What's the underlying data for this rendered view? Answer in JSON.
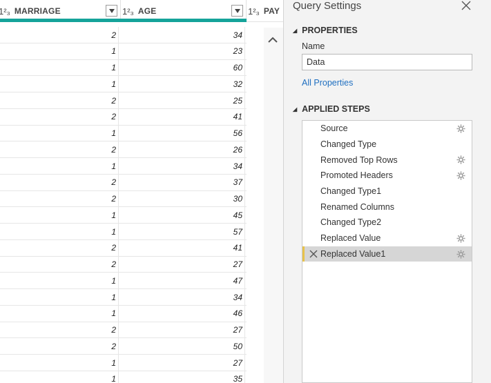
{
  "grid": {
    "columns": [
      {
        "type_icon": "1²₃",
        "label": "MARRIAGE"
      },
      {
        "type_icon": "1²₃",
        "label": "AGE"
      },
      {
        "type_icon": "1²₃",
        "label": "PAY"
      }
    ],
    "rows": [
      {
        "marriage": "2",
        "age": "34"
      },
      {
        "marriage": "1",
        "age": "23"
      },
      {
        "marriage": "1",
        "age": "60"
      },
      {
        "marriage": "1",
        "age": "32"
      },
      {
        "marriage": "2",
        "age": "25"
      },
      {
        "marriage": "2",
        "age": "41"
      },
      {
        "marriage": "1",
        "age": "56"
      },
      {
        "marriage": "2",
        "age": "26"
      },
      {
        "marriage": "1",
        "age": "34"
      },
      {
        "marriage": "2",
        "age": "37"
      },
      {
        "marriage": "2",
        "age": "30"
      },
      {
        "marriage": "1",
        "age": "45"
      },
      {
        "marriage": "1",
        "age": "57"
      },
      {
        "marriage": "2",
        "age": "41"
      },
      {
        "marriage": "2",
        "age": "27"
      },
      {
        "marriage": "1",
        "age": "47"
      },
      {
        "marriage": "1",
        "age": "34"
      },
      {
        "marriage": "1",
        "age": "46"
      },
      {
        "marriage": "2",
        "age": "27"
      },
      {
        "marriage": "2",
        "age": "50"
      },
      {
        "marriage": "1",
        "age": "27"
      },
      {
        "marriage": "1",
        "age": "35"
      }
    ],
    "accent_color": "#15a39a"
  },
  "query_settings": {
    "title": "Query Settings",
    "properties_heading": "PROPERTIES",
    "name_label": "Name",
    "name_value": "Data",
    "all_properties_link": "All Properties",
    "applied_steps_heading": "APPLIED STEPS",
    "steps": [
      {
        "label": "Source",
        "has_gear": true,
        "selected": false
      },
      {
        "label": "Changed Type",
        "has_gear": false,
        "selected": false
      },
      {
        "label": "Removed Top Rows",
        "has_gear": true,
        "selected": false
      },
      {
        "label": "Promoted Headers",
        "has_gear": true,
        "selected": false
      },
      {
        "label": "Changed Type1",
        "has_gear": false,
        "selected": false
      },
      {
        "label": "Renamed Columns",
        "has_gear": false,
        "selected": false
      },
      {
        "label": "Changed Type2",
        "has_gear": false,
        "selected": false
      },
      {
        "label": "Replaced Value",
        "has_gear": true,
        "selected": false
      },
      {
        "label": "Replaced Value1",
        "has_gear": true,
        "selected": true
      }
    ],
    "link_color": "#1f6fc0",
    "selected_marker_color": "#e8c24a"
  }
}
